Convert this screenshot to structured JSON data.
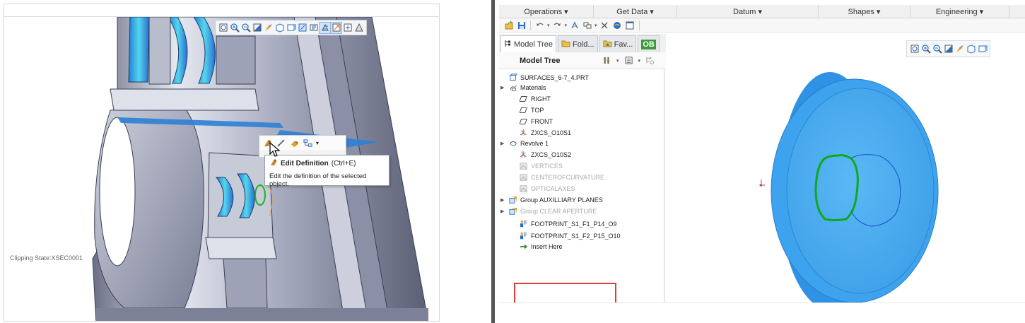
{
  "left": {
    "clipping_state": "Clipping State:XSEC0001",
    "view_toolbar_icons": [
      "refit-icon",
      "zoom-in-icon",
      "zoom-out-icon",
      "repaint-icon",
      "display-style-icon",
      "datum-display-icon",
      "named-views-icon",
      "saved-orientation-icon",
      "annotation-display-icon",
      "section-icon",
      "spin-center-icon",
      "view-manager-icon",
      "perspective-icon"
    ],
    "mini_toolbar_icons": [
      "edit-definition-icon",
      "edit-dimensions-icon",
      "suppress-icon",
      "hierarchy-icon"
    ],
    "tooltip": {
      "title": "Edit Definition",
      "shortcut": "(Ctrl+E)",
      "description": "Edit the definition of the selected object."
    }
  },
  "right": {
    "menu": [
      "Operations",
      "Get Data",
      "Datum",
      "Shapes",
      "Engineering"
    ],
    "quick_access_icons": [
      "new-icon",
      "save-icon",
      "undo-icon",
      "redo-icon",
      "regenerate-icon",
      "windows-icon",
      "close-icon",
      "appearance-icon",
      "new-window-icon"
    ],
    "tabs": [
      {
        "label": "Model Tree",
        "icon": "model-tree-icon"
      },
      {
        "label": "Fold...",
        "icon": "folder-icon"
      },
      {
        "label": "Fav...",
        "icon": "favorites-icon"
      },
      {
        "label": "OB",
        "icon": "ob-badge"
      }
    ],
    "tree_title": "Model Tree",
    "tree_items": [
      {
        "label": "SURFACES_6-7_4.PRT",
        "icon": "part-icon",
        "arrow": "",
        "dim": false
      },
      {
        "label": "Materials",
        "icon": "materials-icon",
        "arrow": "▶",
        "dim": false
      },
      {
        "label": "RIGHT",
        "icon": "datum-plane-icon",
        "arrow": "",
        "dim": false
      },
      {
        "label": "TOP",
        "icon": "datum-plane-icon",
        "arrow": "",
        "dim": false
      },
      {
        "label": "FRONT",
        "icon": "datum-plane-icon",
        "arrow": "",
        "dim": false
      },
      {
        "label": "ZXCS_O10S1",
        "icon": "coordinate-system-icon",
        "arrow": "",
        "dim": false
      },
      {
        "label": "Revolve 1",
        "icon": "revolve-icon",
        "arrow": "▶",
        "dim": false
      },
      {
        "label": "ZXCS_O10S2",
        "icon": "coordinate-system-icon",
        "arrow": "",
        "dim": false
      },
      {
        "label": "VERTICES",
        "icon": "suppressed-feature-icon",
        "arrow": "",
        "dim": true
      },
      {
        "label": "CENTEROFCURVATURE",
        "icon": "suppressed-feature-icon",
        "arrow": "",
        "dim": true
      },
      {
        "label": "OPTICALAXES",
        "icon": "suppressed-feature-icon",
        "arrow": "",
        "dim": true
      },
      {
        "label": "Group AUXILLIARY PLANES",
        "icon": "group-icon",
        "arrow": "▶",
        "dim": false
      },
      {
        "label": "Group CLEAR APERTURE",
        "icon": "group-icon",
        "arrow": "▶",
        "dim": true
      },
      {
        "label": "FOOTPRINT_S1_F1_P14_O9",
        "icon": "footprint-feature-icon",
        "arrow": "",
        "dim": false
      },
      {
        "label": "FOOTPRINT_S1_F2_P15_O10",
        "icon": "footprint-feature-icon",
        "arrow": "",
        "dim": false
      },
      {
        "label": "Insert Here",
        "icon": "insert-here-arrow-icon",
        "arrow": "",
        "dim": false
      }
    ],
    "view_toolbar_icons": [
      "refit-icon",
      "zoom-in-icon",
      "zoom-out-icon",
      "repaint-icon",
      "display-style-icon",
      "datum-display-icon",
      "named-views-icon"
    ],
    "colors": {
      "part_blue": "#43a7f0",
      "footprint_green": "#11a81b",
      "highlight_red": "#e23b3b"
    }
  }
}
